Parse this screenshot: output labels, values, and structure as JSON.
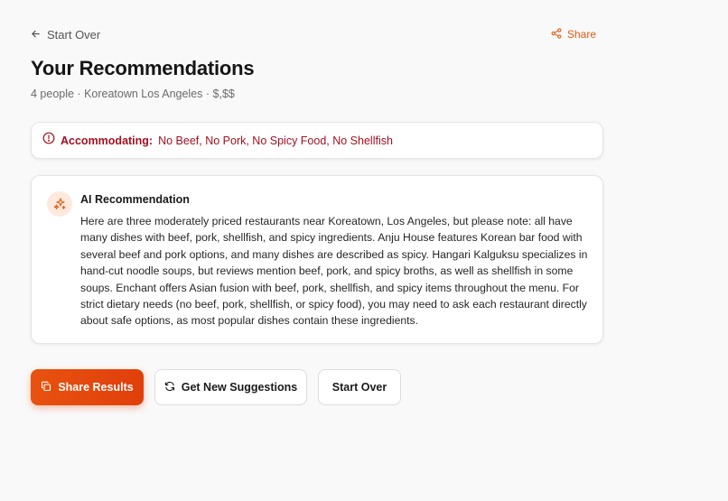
{
  "header": {
    "back_label": "Start Over",
    "share_label": "Share"
  },
  "page": {
    "title": "Your Recommendations",
    "subtitle": "4 people · Koreatown Los Angeles · $,$$"
  },
  "accommodating": {
    "label": "Accommodating:",
    "restrictions": "No Beef, No Pork, No Spicy Food, No Shellfish"
  },
  "ai": {
    "heading": "AI Recommendation",
    "body": "Here are three moderately priced restaurants near Koreatown, Los Angeles, but please note: all have many dishes with beef, pork, shellfish, and spicy ingredients. Anju House features Korean bar food with several beef and pork options, and many dishes are described as spicy. Hangari Kalguksu specializes in hand-cut noodle soups, but reviews mention beef, pork, and spicy broths, as well as shellfish in some soups. Enchant offers Asian fusion with beef, pork, shellfish, and spicy items throughout the menu. For strict dietary needs (no beef, pork, shellfish, or spicy food), you may need to ask each restaurant directly about safe options, as most popular dishes contain these ingredients."
  },
  "actions": {
    "share_results": "Share Results",
    "new_suggestions": "Get New Suggestions",
    "start_over": "Start Over"
  },
  "icons": {
    "back": "arrow-left-icon",
    "share": "share-icon",
    "alert": "alert-circle-icon",
    "ai": "sparkles-icon",
    "copy": "copy-icon",
    "refresh": "refresh-icon"
  },
  "colors": {
    "accent": "#e55a12",
    "alert": "#a3101f",
    "primary_button": "#e8520f"
  }
}
